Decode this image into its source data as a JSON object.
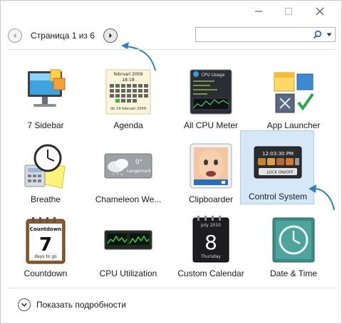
{
  "window": {
    "min_icon": "minimize-icon",
    "max_icon": "maximize-icon",
    "close_icon": "close-icon"
  },
  "nav": {
    "page_label": "Страница 1 из 6",
    "prev_icon": "chevron-left-icon",
    "next_icon": "chevron-right-icon"
  },
  "search": {
    "value": "",
    "icon": "search-icon",
    "dropdown_icon": "caret-down-icon"
  },
  "gadgets": [
    {
      "label": "7 Sidebar",
      "icon": "monitor-sidebar-icon"
    },
    {
      "label": "Agenda",
      "icon": "calendar-agenda-icon"
    },
    {
      "label": "All CPU Meter",
      "icon": "cpu-meter-icon"
    },
    {
      "label": "App Launcher",
      "icon": "app-launcher-icon"
    },
    {
      "label": "Breathe",
      "icon": "breathe-icon"
    },
    {
      "label": "Chameleon We...",
      "icon": "weather-icon"
    },
    {
      "label": "Clipboarder",
      "icon": "clipboarder-icon"
    },
    {
      "label": "Control System",
      "icon": "control-system-icon",
      "selected": true
    },
    {
      "label": "Countdown",
      "icon": "countdown-icon"
    },
    {
      "label": "CPU Utilization",
      "icon": "cpu-utilization-icon"
    },
    {
      "label": "Custom Calendar",
      "icon": "custom-calendar-icon"
    },
    {
      "label": "Date & Time",
      "icon": "date-time-icon"
    }
  ],
  "thumb_text": {
    "agenda_header": "februari 2009",
    "agenda_time": "18:18",
    "agenda_footer": "do 19 februari 2009",
    "cpu_title": "CPU Usage",
    "weather_temp": "0°",
    "weather_place": "Langemark",
    "control_time": "12:03:30 PM",
    "control_lock": "LOCK ON/OFF",
    "countdown_title": "Countdown",
    "countdown_number": "7",
    "countdown_sub": "days to go",
    "calendar_header": "July 2010",
    "calendar_day": "8",
    "calendar_weekday": "Thursday"
  },
  "footer": {
    "details_label": "Показать подробности",
    "details_icon": "chevron-down-circle-icon"
  },
  "colors": {
    "selection_bg": "#d6e8f8",
    "selection_border": "#a8d0f0",
    "arrow": "#2f7fc0"
  }
}
